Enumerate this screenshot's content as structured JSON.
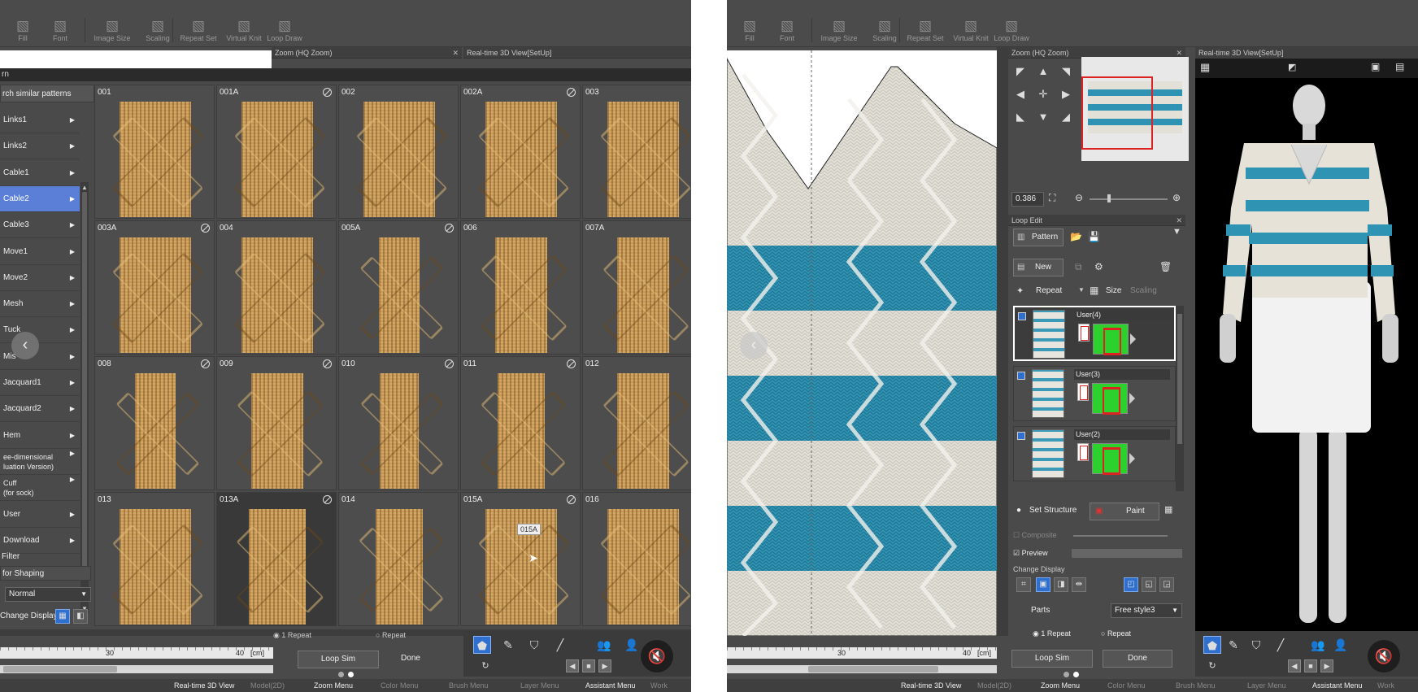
{
  "toolbar": {
    "items": [
      "Fill",
      "Font",
      "Image Size",
      "Scaling",
      "Repeat Set",
      "Virtual Knit",
      "Loop Draw"
    ],
    "icons": [
      "fill-icon",
      "font-icon",
      "image-size-icon",
      "scaling-icon",
      "repeat-set-icon",
      "virtual-knit-icon",
      "loop-draw-icon"
    ]
  },
  "left": {
    "zoom_panel_title": "Zoom (HQ Zoom)",
    "view3d_title": "Real-time 3D View[SetUp]",
    "dialog_title": "rn",
    "search_label": "rch similar patterns",
    "categories": [
      {
        "label": "Links1"
      },
      {
        "label": "Links2"
      },
      {
        "label": "Cable1"
      },
      {
        "label": "Cable2",
        "selected": true
      },
      {
        "label": "Cable3"
      },
      {
        "label": "Move1"
      },
      {
        "label": "Move2"
      },
      {
        "label": "Mesh"
      },
      {
        "label": "Tuck"
      },
      {
        "label": "Mis"
      },
      {
        "label": "Jacquard1"
      },
      {
        "label": "Jacquard2"
      },
      {
        "label": "Hem"
      },
      {
        "label": "ee-dimensional\nluation Version)"
      },
      {
        "label": "Cuff\n(for sock)"
      },
      {
        "label": "User"
      },
      {
        "label": "Download"
      }
    ],
    "patterns": [
      {
        "id": "001",
        "badge": false
      },
      {
        "id": "001A",
        "badge": true
      },
      {
        "id": "002",
        "badge": false
      },
      {
        "id": "002A",
        "badge": true
      },
      {
        "id": "003",
        "badge": false
      },
      {
        "id": "003A",
        "badge": true
      },
      {
        "id": "004",
        "badge": false
      },
      {
        "id": "005A",
        "badge": true
      },
      {
        "id": "006",
        "badge": false
      },
      {
        "id": "007A",
        "badge": false
      },
      {
        "id": "008",
        "badge": true
      },
      {
        "id": "009",
        "badge": true
      },
      {
        "id": "010",
        "badge": true
      },
      {
        "id": "011",
        "badge": true
      },
      {
        "id": "012",
        "badge": false
      },
      {
        "id": "013",
        "badge": false
      },
      {
        "id": "013A",
        "badge": true,
        "highlight": true
      },
      {
        "id": "014",
        "badge": false
      },
      {
        "id": "015A",
        "badge": true
      },
      {
        "id": "016",
        "badge": false
      }
    ],
    "tooltip": "015A",
    "filter_label": "Filter",
    "shaping_label": "for Shaping",
    "normal_value": "Normal",
    "change_display_label": "Change Display",
    "radio_one_repeat": "1 Repeat",
    "radio_repeat": "Repeat",
    "loop_sim": "Loop Sim",
    "done": "Done",
    "ruler_30": "30",
    "ruler_40": "40",
    "ruler_unit": "[cm]"
  },
  "status_bar": [
    "Real-time 3D View",
    "Model(2D)",
    "Zoom Menu",
    "Color Menu",
    "Brush Menu",
    "Layer Menu",
    "Assistant Menu",
    "Work"
  ],
  "right": {
    "zoom_title": "Zoom (HQ Zoom)",
    "view3d_title": "Real-time 3D View[SetUp]",
    "zoom_value": "0.386",
    "loop_edit_title": "Loop Edit",
    "pattern_btn": "Pattern",
    "new_btn": "New",
    "repeat_btn": "Repeat",
    "size_btn": "Size",
    "scaling_btn": "Scaling",
    "layers": [
      "User(4)",
      "User(3)",
      "User(2)"
    ],
    "set_structure": "Set Structure",
    "paint_btn": "Paint",
    "composite_label": "Composite",
    "preview_label": "Preview",
    "change_display_label": "Change Display",
    "parts_label": "Parts",
    "parts_value": "Free style3",
    "radio_one_repeat": "1 Repeat",
    "radio_repeat": "Repeat",
    "loop_sim": "Loop Sim",
    "done": "Done",
    "ruler_30": "30",
    "ruler_40": "40",
    "ruler_unit": "[cm]"
  },
  "colors": {
    "accent": "#2e6fd0",
    "stripe": "#3a9ab8",
    "knit": "#c99a56",
    "cream": "#e8e5de",
    "selected_category": "#5b7fd6"
  }
}
